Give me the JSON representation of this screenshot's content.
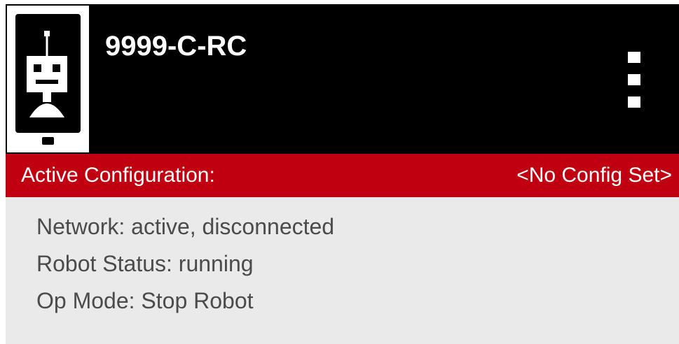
{
  "header": {
    "title": "9999-C-RC",
    "logo_icon": "robot-phone-icon",
    "menu_icon": "overflow-menu-icon"
  },
  "config_bar": {
    "label": "Active Configuration:",
    "value": "<No Config Set>"
  },
  "status": {
    "network": "Network: active, disconnected",
    "robot_status": "Robot Status: running",
    "op_mode": "Op Mode: Stop Robot"
  },
  "colors": {
    "header_background": "#000000",
    "accent_red": "#c00010",
    "panel_background": "#eaeaea",
    "status_text": "#4b4b4b"
  }
}
